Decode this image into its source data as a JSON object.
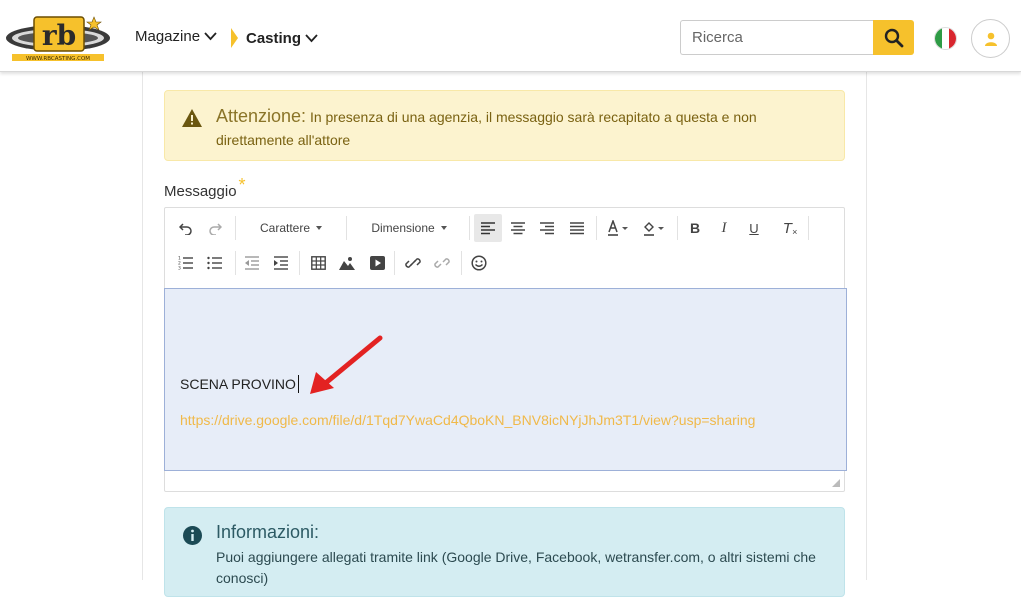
{
  "header": {
    "logo_text": "rb",
    "logo_subtext": "WWW.RBCASTING.COM",
    "nav": [
      {
        "label": "Magazine"
      },
      {
        "label": "Casting"
      }
    ],
    "search_placeholder": "Ricerca",
    "colors": {
      "accent": "#f6c12c"
    }
  },
  "warning": {
    "title": "Attenzione:",
    "text": " In presenza di una agenzia, il messaggio sarà recapitato a questa e non direttamente all'attore"
  },
  "message": {
    "label": "Messaggio",
    "required_mark": "*"
  },
  "toolbar": {
    "font_label": "Carattere",
    "size_label": "Dimensione",
    "bold": "B",
    "italic": "I",
    "underline": "U",
    "clear_format": "T"
  },
  "editor": {
    "line1": "SCENA PROVINO",
    "link": "https://drive.google.com/file/d/1Tqd7YwaCd4QboKN_BNV8icNYjJhJm3T1/view?usp=sharing"
  },
  "info": {
    "title": "Informazioni:",
    "text": "Puoi aggiungere allegati tramite link (Google Drive, Facebook, wetransfer.com, o altri sistemi che conosci)"
  }
}
